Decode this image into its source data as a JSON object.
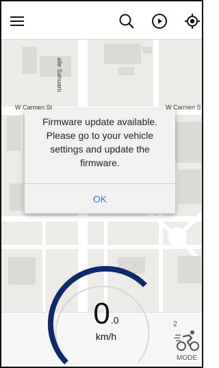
{
  "topbar": {
    "menu_icon": "menu-icon",
    "search_icon": "search-icon",
    "play_icon": "play-circle-icon",
    "locate_icon": "locate-icon"
  },
  "map": {
    "street_left": "W Carmen St",
    "street_right": "W Carmen S",
    "street_vertical": "alle Sahuaro"
  },
  "dialog": {
    "message": "Firmware update available. Please go to your vehicle settings and update the firmware.",
    "ok_label": "OK"
  },
  "speedometer": {
    "speed_int": "0",
    "speed_dec": ".0",
    "unit": "km/h"
  },
  "mode": {
    "level": "2",
    "label": "MODE",
    "icon": "cyclist-icon"
  },
  "colors": {
    "gauge_arc": "#0f2a6b",
    "ok_text": "#2b7bd6",
    "map_bg": "#ecebe7"
  }
}
